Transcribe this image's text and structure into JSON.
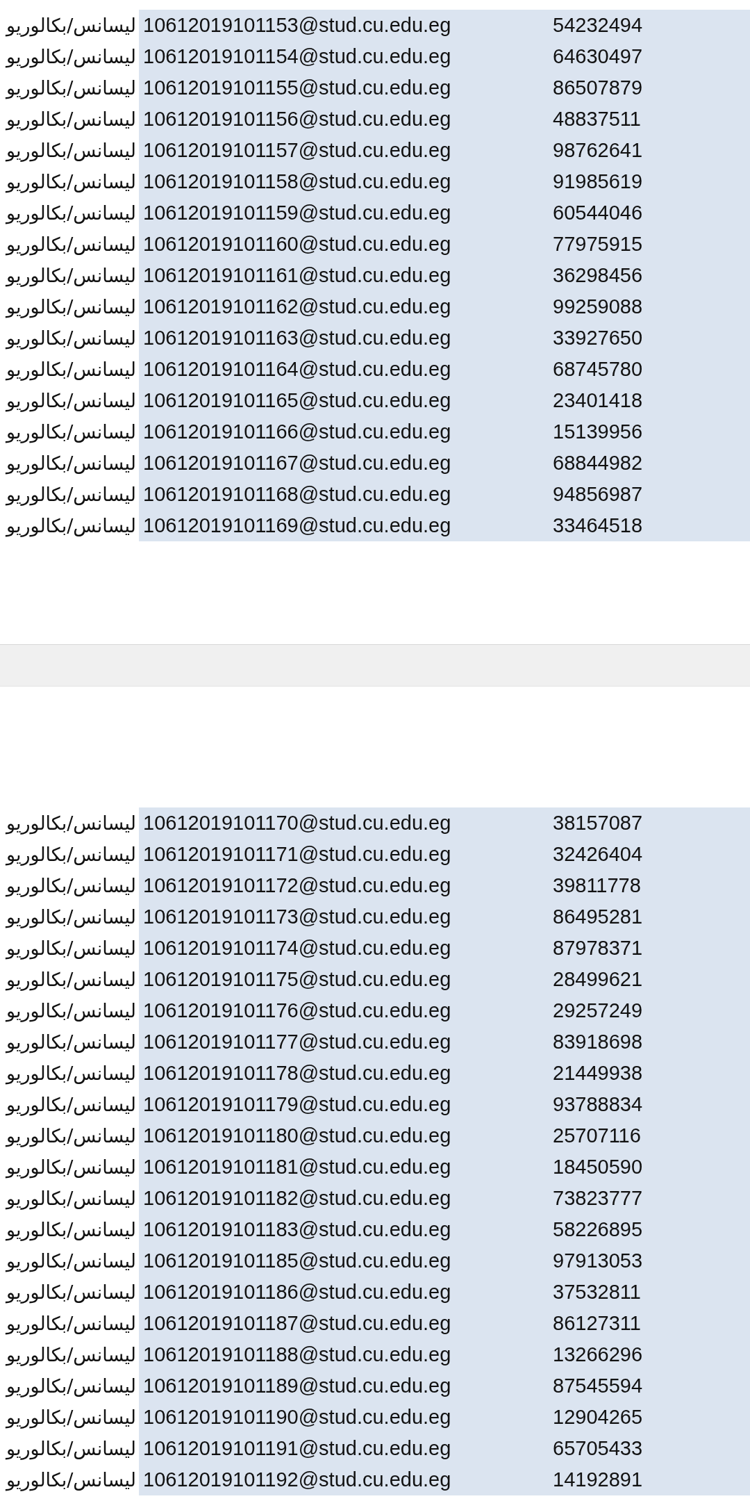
{
  "pages": [
    {
      "rows": [
        {
          "degree": "ليسانس/بكالوريو",
          "email": "10612019101153@stud.cu.edu.eg",
          "code": "54232494"
        },
        {
          "degree": "ليسانس/بكالوريو",
          "email": "10612019101154@stud.cu.edu.eg",
          "code": "64630497"
        },
        {
          "degree": "ليسانس/بكالوريو",
          "email": "10612019101155@stud.cu.edu.eg",
          "code": "86507879"
        },
        {
          "degree": "ليسانس/بكالوريو",
          "email": "10612019101156@stud.cu.edu.eg",
          "code": "48837511"
        },
        {
          "degree": "ليسانس/بكالوريو",
          "email": "10612019101157@stud.cu.edu.eg",
          "code": "98762641"
        },
        {
          "degree": "ليسانس/بكالوريو",
          "email": "10612019101158@stud.cu.edu.eg",
          "code": "91985619"
        },
        {
          "degree": "ليسانس/بكالوريو",
          "email": "10612019101159@stud.cu.edu.eg",
          "code": "60544046"
        },
        {
          "degree": "ليسانس/بكالوريو",
          "email": "10612019101160@stud.cu.edu.eg",
          "code": "77975915"
        },
        {
          "degree": "ليسانس/بكالوريو",
          "email": "10612019101161@stud.cu.edu.eg",
          "code": "36298456"
        },
        {
          "degree": "ليسانس/بكالوريو",
          "email": "10612019101162@stud.cu.edu.eg",
          "code": "99259088"
        },
        {
          "degree": "ليسانس/بكالوريو",
          "email": "10612019101163@stud.cu.edu.eg",
          "code": "33927650"
        },
        {
          "degree": "ليسانس/بكالوريو",
          "email": "10612019101164@stud.cu.edu.eg",
          "code": "68745780"
        },
        {
          "degree": "ليسانس/بكالوريو",
          "email": "10612019101165@stud.cu.edu.eg",
          "code": "23401418"
        },
        {
          "degree": "ليسانس/بكالوريو",
          "email": "10612019101166@stud.cu.edu.eg",
          "code": "15139956"
        },
        {
          "degree": "ليسانس/بكالوريو",
          "email": "10612019101167@stud.cu.edu.eg",
          "code": "68844982"
        },
        {
          "degree": "ليسانس/بكالوريو",
          "email": "10612019101168@stud.cu.edu.eg",
          "code": "94856987"
        },
        {
          "degree": "ليسانس/بكالوريو",
          "email": "10612019101169@stud.cu.edu.eg",
          "code": "33464518"
        }
      ]
    },
    {
      "rows": [
        {
          "degree": "ليسانس/بكالوريو",
          "email": "10612019101170@stud.cu.edu.eg",
          "code": "38157087"
        },
        {
          "degree": "ليسانس/بكالوريو",
          "email": "10612019101171@stud.cu.edu.eg",
          "code": "32426404"
        },
        {
          "degree": "ليسانس/بكالوريو",
          "email": "10612019101172@stud.cu.edu.eg",
          "code": "39811778"
        },
        {
          "degree": "ليسانس/بكالوريو",
          "email": "10612019101173@stud.cu.edu.eg",
          "code": "86495281"
        },
        {
          "degree": "ليسانس/بكالوريو",
          "email": "10612019101174@stud.cu.edu.eg",
          "code": "87978371"
        },
        {
          "degree": "ليسانس/بكالوريو",
          "email": "10612019101175@stud.cu.edu.eg",
          "code": "28499621"
        },
        {
          "degree": "ليسانس/بكالوريو",
          "email": "10612019101176@stud.cu.edu.eg",
          "code": "29257249"
        },
        {
          "degree": "ليسانس/بكالوريو",
          "email": "10612019101177@stud.cu.edu.eg",
          "code": "83918698"
        },
        {
          "degree": "ليسانس/بكالوريو",
          "email": "10612019101178@stud.cu.edu.eg",
          "code": "21449938"
        },
        {
          "degree": "ليسانس/بكالوريو",
          "email": "10612019101179@stud.cu.edu.eg",
          "code": "93788834"
        },
        {
          "degree": "ليسانس/بكالوريو",
          "email": "10612019101180@stud.cu.edu.eg",
          "code": "25707116"
        },
        {
          "degree": "ليسانس/بكالوريو",
          "email": "10612019101181@stud.cu.edu.eg",
          "code": "18450590"
        },
        {
          "degree": "ليسانس/بكالوريو",
          "email": "10612019101182@stud.cu.edu.eg",
          "code": "73823777"
        },
        {
          "degree": "ليسانس/بكالوريو",
          "email": "10612019101183@stud.cu.edu.eg",
          "code": "58226895"
        },
        {
          "degree": "ليسانس/بكالوريو",
          "email": "10612019101185@stud.cu.edu.eg",
          "code": "97913053"
        },
        {
          "degree": "ليسانس/بكالوريو",
          "email": "10612019101186@stud.cu.edu.eg",
          "code": "37532811"
        },
        {
          "degree": "ليسانس/بكالوريو",
          "email": "10612019101187@stud.cu.edu.eg",
          "code": "86127311"
        },
        {
          "degree": "ليسانس/بكالوريو",
          "email": "10612019101188@stud.cu.edu.eg",
          "code": "13266296"
        },
        {
          "degree": "ليسانس/بكالوريو",
          "email": "10612019101189@stud.cu.edu.eg",
          "code": "87545594"
        },
        {
          "degree": "ليسانس/بكالوريو",
          "email": "10612019101190@stud.cu.edu.eg",
          "code": "12904265"
        },
        {
          "degree": "ليسانس/بكالوريو",
          "email": "10612019101191@stud.cu.edu.eg",
          "code": "65705433"
        },
        {
          "degree": "ليسانس/بكالوريو",
          "email": "10612019101192@stud.cu.edu.eg",
          "code": "14192891"
        }
      ]
    }
  ]
}
